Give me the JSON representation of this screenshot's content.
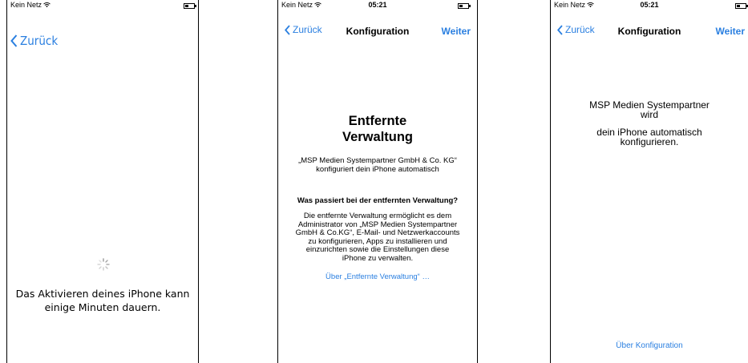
{
  "screen1": {
    "carrier": "Kein Netz",
    "back_label": "Zurück",
    "message_line1": "Das Aktivieren deines iPhone kann",
    "message_line2": "einige Minuten dauern."
  },
  "screen2": {
    "carrier": "Kein Netz",
    "time": "05:21",
    "back_label": "Zurück",
    "title": "Konfiguration",
    "next_label": "Weiter",
    "heading_line1": "Entfernte",
    "heading_line2": "Verwaltung",
    "intro": "„MSP Medien Systempartner GmbH & Co. KG“ konfiguriert dein iPhone automatisch",
    "question": "Was passiert bei der entfernten Verwaltung?",
    "explanation": "Die entfernte Verwaltung ermöglicht es dem Administrator von „MSP Medien Systempartner GmbH & Co.KG“, E-Mail- und Netzwerkaccounts zu konfigurieren, Apps zu installieren und einzurichten sowie die Einstellungen diese iPhone zu verwalten.",
    "link": "Über „Entfernte Verwaltung“ …"
  },
  "screen3": {
    "carrier": "Kein Netz",
    "time": "05:21",
    "back_label": "Zurück",
    "title": "Konfiguration",
    "next_label": "Weiter",
    "org_line1": "MSP Medien Systempartner",
    "org_line2": "wird",
    "line3": "dein iPhone automatisch",
    "line4": "konfigurieren.",
    "bottom_link": "Über Konfiguration"
  },
  "colors": {
    "link": "#2a7fe0"
  },
  "icons": [
    "wifi-icon",
    "battery-icon",
    "chevron-left-icon",
    "spinner-icon"
  ]
}
